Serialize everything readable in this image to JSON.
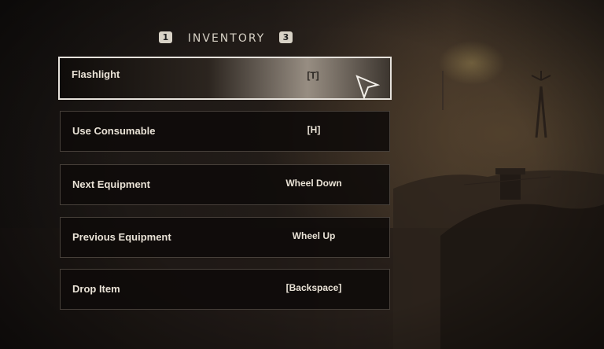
{
  "header": {
    "left_badge": "1",
    "title": "INVENTORY",
    "right_badge": "3"
  },
  "bindings": [
    {
      "action": "Flashlight",
      "key": "[T]",
      "selected": true
    },
    {
      "action": "Use Consumable",
      "key": "[H]",
      "selected": false
    },
    {
      "action": "Next Equipment",
      "key": "Wheel Down",
      "selected": false
    },
    {
      "action": "Previous Equipment",
      "key": "Wheel Up",
      "selected": false
    },
    {
      "action": "Drop Item",
      "key": "[Backspace]",
      "selected": false
    }
  ],
  "colors": {
    "text": "#e9e2d6",
    "row_bg": "#0e0b09",
    "selected_border": "#e6e2dc"
  },
  "icons": {
    "cursor": "mouse-pointer-icon"
  }
}
